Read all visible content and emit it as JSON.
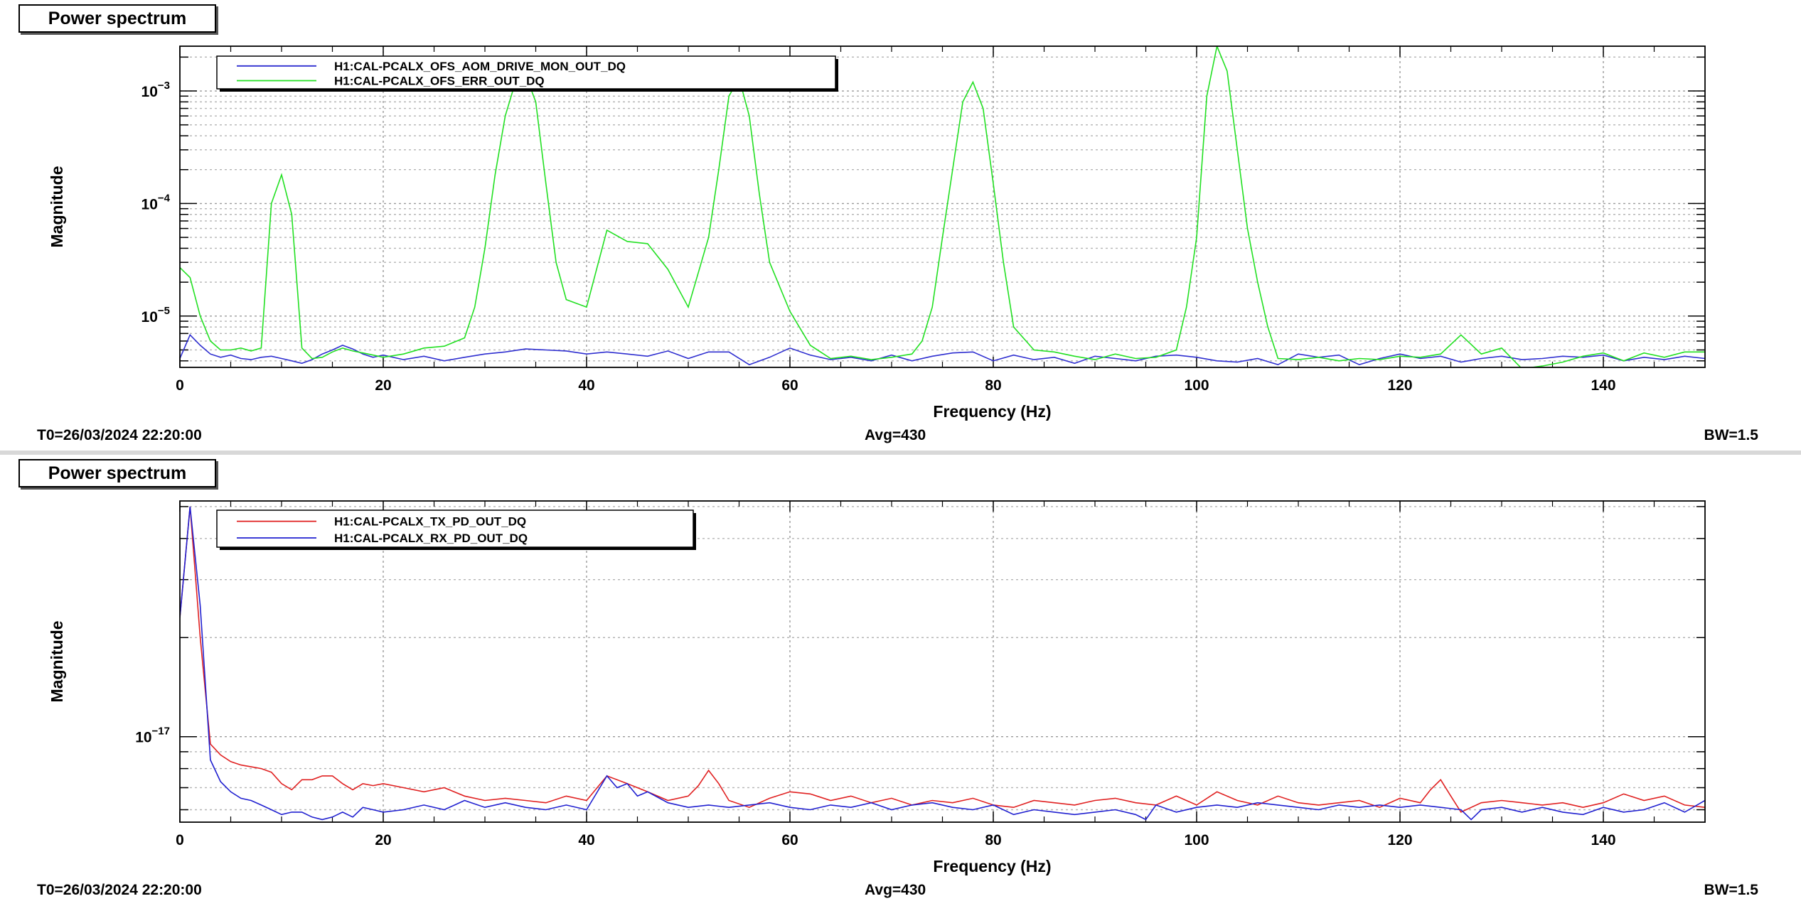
{
  "chart_data": [
    {
      "type": "line",
      "title": "Power spectrum",
      "xlabel": "Frequency (Hz)",
      "ylabel": "Magnitude",
      "xlim": [
        0,
        150
      ],
      "ylim": [
        3.5e-06,
        0.0025
      ],
      "yscale": "log",
      "grid": true,
      "legend_position": "top-left",
      "x_ticks": [
        "0",
        "20",
        "40",
        "60",
        "80",
        "100",
        "120",
        "140"
      ],
      "y_ticks": [
        {
          "value": 1e-05,
          "base": "10",
          "exp": "-5"
        },
        {
          "value": 0.0001,
          "base": "10",
          "exp": "-4"
        },
        {
          "value": 0.001,
          "base": "10",
          "exp": "-3"
        }
      ],
      "footer": {
        "t0": "T0=26/03/2024 22:20:00",
        "avg": "Avg=430",
        "bw": "BW=1.5"
      },
      "series": [
        {
          "name": "H1:CAL-PCALX_OFS_AOM_DRIVE_MON_OUT_DQ",
          "color": "#2f2fd0",
          "x": [
            0,
            1,
            2,
            3,
            4,
            5,
            6,
            7,
            8,
            9,
            10,
            11,
            12,
            13,
            14,
            15,
            16,
            17,
            18,
            19,
            20,
            22,
            24,
            26,
            28,
            30,
            32,
            34,
            36,
            38,
            40,
            42,
            44,
            46,
            48,
            50,
            52,
            54,
            56,
            58,
            60,
            62,
            64,
            66,
            68,
            70,
            72,
            74,
            76,
            78,
            80,
            82,
            84,
            86,
            88,
            90,
            92,
            94,
            96,
            98,
            100,
            102,
            104,
            106,
            108,
            110,
            112,
            114,
            116,
            118,
            120,
            122,
            124,
            126,
            128,
            130,
            132,
            134,
            136,
            138,
            140,
            142,
            144,
            146,
            148,
            150
          ],
          "y": [
            4.2e-06,
            6.8e-06,
            5.5e-06,
            4.6e-06,
            4.3e-06,
            4.5e-06,
            4.2e-06,
            4.1e-06,
            4.3e-06,
            4.4e-06,
            4.2e-06,
            4e-06,
            3.8e-06,
            4.1e-06,
            4.6e-06,
            5e-06,
            5.5e-06,
            5.1e-06,
            4.6e-06,
            4.3e-06,
            4.5e-06,
            4.1e-06,
            4.4e-06,
            4e-06,
            4.3e-06,
            4.6e-06,
            4.8e-06,
            5.1e-06,
            5e-06,
            4.9e-06,
            4.6e-06,
            4.8e-06,
            4.6e-06,
            4.4e-06,
            4.9e-06,
            4.2e-06,
            4.8e-06,
            4.8e-06,
            3.7e-06,
            4.3e-06,
            5.2e-06,
            4.5e-06,
            4.1e-06,
            4.3e-06,
            4e-06,
            4.5e-06,
            4e-06,
            4.4e-06,
            4.7e-06,
            4.8e-06,
            4e-06,
            4.5e-06,
            4.1e-06,
            4.3e-06,
            3.8e-06,
            4.4e-06,
            4.2e-06,
            4e-06,
            4.4e-06,
            4.5e-06,
            4.3e-06,
            4e-06,
            3.9e-06,
            4.2e-06,
            3.7e-06,
            4.6e-06,
            4.3e-06,
            4.5e-06,
            3.7e-06,
            4.2e-06,
            4.6e-06,
            4.2e-06,
            4.4e-06,
            3.9e-06,
            4.2e-06,
            4.4e-06,
            4.1e-06,
            4.2e-06,
            4.4e-06,
            4.3e-06,
            4.5e-06,
            4e-06,
            4.3e-06,
            4.1e-06,
            4.4e-06,
            4.2e-06
          ]
        },
        {
          "name": "H1:CAL-PCALX_OFS_ERR_OUT_DQ",
          "color": "#22e022",
          "x": [
            0,
            1,
            2,
            3,
            4,
            5,
            6,
            7,
            8,
            9,
            10,
            11,
            12,
            13,
            14,
            15,
            16,
            17,
            18,
            19,
            20,
            22,
            24,
            26,
            28,
            29,
            30,
            31,
            32,
            33,
            34,
            35,
            36,
            37,
            38,
            40,
            42,
            44,
            46,
            48,
            50,
            52,
            53,
            54,
            55,
            56,
            57,
            58,
            60,
            62,
            64,
            66,
            68,
            70,
            72,
            73,
            74,
            75,
            76,
            77,
            78,
            79,
            80,
            81,
            82,
            84,
            86,
            88,
            90,
            92,
            94,
            96,
            98,
            99,
            100,
            101,
            102,
            103,
            104,
            105,
            106,
            107,
            108,
            110,
            112,
            114,
            116,
            118,
            120,
            122,
            124,
            126,
            128,
            130,
            132,
            134,
            136,
            138,
            140,
            142,
            144,
            146,
            148,
            150
          ],
          "y": [
            2.7e-05,
            2.2e-05,
            1e-05,
            6e-06,
            5e-06,
            5e-06,
            5.2e-06,
            4.9e-06,
            5.2e-06,
            0.0001,
            0.00018,
            8e-05,
            5.2e-06,
            4.2e-06,
            4.3e-06,
            4.8e-06,
            5.2e-06,
            4.9e-06,
            4.7e-06,
            4.5e-06,
            4.3e-06,
            4.6e-06,
            5.2e-06,
            5.4e-06,
            6.4e-06,
            1.2e-05,
            4e-05,
            0.00018,
            0.0006,
            0.0012,
            0.0014,
            0.0008,
            0.00015,
            3e-05,
            1.4e-05,
            1.2e-05,
            5.8e-05,
            4.6e-05,
            4.4e-05,
            2.6e-05,
            1.2e-05,
            5e-05,
            0.0002,
            0.0009,
            0.0013,
            0.0006,
            0.00012,
            3e-05,
            1.1e-05,
            5.5e-06,
            4.2e-06,
            4.4e-06,
            4.1e-06,
            4.3e-06,
            4.6e-06,
            6e-06,
            1.2e-05,
            5e-05,
            0.0002,
            0.0008,
            0.0012,
            0.0007,
            0.00015,
            3e-05,
            8e-06,
            5e-06,
            4.8e-06,
            4.4e-06,
            4.1e-06,
            4.6e-06,
            4.2e-06,
            4.3e-06,
            5e-06,
            1.2e-05,
            5e-05,
            0.0009,
            0.0025,
            0.0015,
            0.0003,
            6e-05,
            2e-05,
            8e-06,
            4.2e-06,
            4.1e-06,
            4.3e-06,
            4e-06,
            4.2e-06,
            4.1e-06,
            4.4e-06,
            4.3e-06,
            4.6e-06,
            6.8e-06,
            4.6e-06,
            5.2e-06,
            3.4e-06,
            3.6e-06,
            3.9e-06,
            4.4e-06,
            4.7e-06,
            4e-06,
            4.7e-06,
            4.3e-06,
            4.8e-06,
            4.8e-06
          ]
        }
      ]
    },
    {
      "type": "line",
      "title": "Power spectrum",
      "xlabel": "Frequency (Hz)",
      "ylabel": "Magnitude",
      "xlim": [
        0,
        150
      ],
      "ylim": [
        5.5e-18,
        5.2e-17
      ],
      "yscale": "log",
      "grid": true,
      "legend_position": "top-left",
      "x_ticks": [
        "0",
        "20",
        "40",
        "60",
        "80",
        "100",
        "120",
        "140"
      ],
      "y_ticks": [
        {
          "value": 1e-17,
          "base": "10",
          "exp": "-17"
        }
      ],
      "footer": {
        "t0": "T0=26/03/2024 22:20:00",
        "avg": "Avg=430",
        "bw": "BW=1.5"
      },
      "series": [
        {
          "name": "H1:CAL-PCALX_TX_PD_OUT_DQ",
          "color": "#e02020",
          "x": [
            0,
            1,
            2,
            3,
            4,
            5,
            6,
            7,
            8,
            9,
            10,
            11,
            12,
            13,
            14,
            15,
            16,
            17,
            18,
            19,
            20,
            22,
            24,
            26,
            28,
            30,
            32,
            34,
            36,
            38,
            40,
            42,
            44,
            46,
            48,
            50,
            51,
            52,
            53,
            54,
            56,
            58,
            60,
            62,
            64,
            66,
            68,
            70,
            72,
            74,
            76,
            78,
            80,
            82,
            84,
            86,
            88,
            90,
            92,
            94,
            96,
            98,
            100,
            102,
            104,
            106,
            108,
            110,
            112,
            114,
            116,
            118,
            120,
            122,
            123,
            124,
            125,
            126,
            128,
            130,
            132,
            134,
            136,
            138,
            140,
            142,
            144,
            146,
            148,
            150
          ],
          "y": [
            2.3e-17,
            5e-17,
            2e-17,
            9.5e-18,
            8.8e-18,
            8.4e-18,
            8.2e-18,
            8.1e-18,
            8e-18,
            7.8e-18,
            7.2e-18,
            6.9e-18,
            7.4e-18,
            7.4e-18,
            7.6e-18,
            7.6e-18,
            7.2e-18,
            6.9e-18,
            7.2e-18,
            7.1e-18,
            7.2e-18,
            7e-18,
            6.8e-18,
            7e-18,
            6.6e-18,
            6.4e-18,
            6.5e-18,
            6.4e-18,
            6.3e-18,
            6.6e-18,
            6.4e-18,
            7.6e-18,
            7.2e-18,
            6.8e-18,
            6.4e-18,
            6.6e-18,
            7.1e-18,
            7.9e-18,
            7.2e-18,
            6.4e-18,
            6.1e-18,
            6.5e-18,
            6.8e-18,
            6.7e-18,
            6.4e-18,
            6.6e-18,
            6.3e-18,
            6.5e-18,
            6.2e-18,
            6.4e-18,
            6.3e-18,
            6.5e-18,
            6.2e-18,
            6.1e-18,
            6.4e-18,
            6.3e-18,
            6.2e-18,
            6.4e-18,
            6.5e-18,
            6.3e-18,
            6.2e-18,
            6.6e-18,
            6.2e-18,
            6.8e-18,
            6.4e-18,
            6.2e-18,
            6.6e-18,
            6.3e-18,
            6.2e-18,
            6.3e-18,
            6.4e-18,
            6.1e-18,
            6.5e-18,
            6.3e-18,
            6.9e-18,
            7.4e-18,
            6.6e-18,
            5.9e-18,
            6.3e-18,
            6.4e-18,
            6.3e-18,
            6.2e-18,
            6.3e-18,
            6.1e-18,
            6.3e-18,
            6.7e-18,
            6.4e-18,
            6.6e-18,
            6.2e-18,
            6.1e-18
          ]
        },
        {
          "name": "H1:CAL-PCALX_RX_PD_OUT_DQ",
          "color": "#2020d0",
          "x": [
            0,
            1,
            2,
            3,
            4,
            5,
            6,
            7,
            8,
            9,
            10,
            11,
            12,
            13,
            14,
            15,
            16,
            17,
            18,
            19,
            20,
            22,
            24,
            26,
            28,
            30,
            32,
            34,
            36,
            38,
            40,
            42,
            43,
            44,
            45,
            46,
            48,
            50,
            52,
            54,
            56,
            58,
            60,
            62,
            64,
            66,
            68,
            70,
            72,
            74,
            76,
            78,
            80,
            82,
            84,
            86,
            88,
            90,
            92,
            94,
            95,
            96,
            98,
            100,
            102,
            104,
            106,
            108,
            110,
            112,
            114,
            116,
            118,
            120,
            122,
            124,
            126,
            127,
            128,
            130,
            132,
            134,
            136,
            138,
            140,
            142,
            144,
            146,
            148,
            150
          ],
          "y": [
            2.3e-17,
            5e-17,
            2.5e-17,
            8.5e-18,
            7.3e-18,
            6.8e-18,
            6.5e-18,
            6.4e-18,
            6.2e-18,
            6e-18,
            5.8e-18,
            5.9e-18,
            5.9e-18,
            5.7e-18,
            5.6e-18,
            5.7e-18,
            5.9e-18,
            5.7e-18,
            6.1e-18,
            6e-18,
            5.9e-18,
            6e-18,
            6.2e-18,
            6e-18,
            6.4e-18,
            6.1e-18,
            6.3e-18,
            6.1e-18,
            6e-18,
            6.2e-18,
            6e-18,
            7.6e-18,
            7e-18,
            7.2e-18,
            6.6e-18,
            6.8e-18,
            6.3e-18,
            6.1e-18,
            6.2e-18,
            6.1e-18,
            6.2e-18,
            6.3e-18,
            6.1e-18,
            6e-18,
            6.2e-18,
            6.1e-18,
            6.3e-18,
            6e-18,
            6.2e-18,
            6.3e-18,
            6.1e-18,
            6e-18,
            6.2e-18,
            5.8e-18,
            6e-18,
            5.9e-18,
            5.8e-18,
            5.9e-18,
            6e-18,
            5.8e-18,
            5.6e-18,
            6.2e-18,
            5.9e-18,
            6.1e-18,
            6.2e-18,
            6.1e-18,
            6.3e-18,
            6.2e-18,
            6.1e-18,
            6e-18,
            6.2e-18,
            6.1e-18,
            6.2e-18,
            6.1e-18,
            6.2e-18,
            6.1e-18,
            6e-18,
            5.6e-18,
            6e-18,
            6.1e-18,
            5.9e-18,
            6.1e-18,
            5.9e-18,
            5.8e-18,
            6.1e-18,
            5.9e-18,
            6e-18,
            6.3e-18,
            5.9e-18,
            6.4e-18
          ]
        }
      ]
    }
  ]
}
